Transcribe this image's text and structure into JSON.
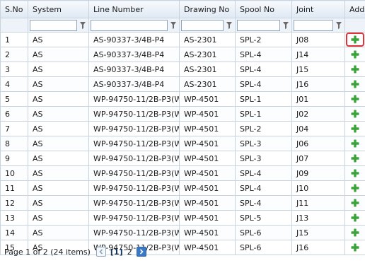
{
  "columns": [
    "S.No",
    "System",
    "Line Number",
    "Drawing No",
    "Spool No",
    "Joint",
    "Add"
  ],
  "filter_values": [
    "",
    "",
    "",
    "",
    ""
  ],
  "rows": [
    {
      "sno": "1",
      "system": "AS",
      "line": "AS-90337-3/4B-P4",
      "drawing": "AS-2301",
      "spool": "SPL-2",
      "joint": "J08"
    },
    {
      "sno": "2",
      "system": "AS",
      "line": "AS-90337-3/4B-P4",
      "drawing": "AS-2301",
      "spool": "SPL-4",
      "joint": "J14"
    },
    {
      "sno": "3",
      "system": "AS",
      "line": "AS-90337-3/4B-P4",
      "drawing": "AS-2301",
      "spool": "SPL-4",
      "joint": "J15"
    },
    {
      "sno": "4",
      "system": "AS",
      "line": "AS-90337-3/4B-P4",
      "drawing": "AS-2301",
      "spool": "SPL-4",
      "joint": "J16"
    },
    {
      "sno": "5",
      "system": "AS",
      "line": "WP-94750-11/2B-P3(WP)",
      "drawing": "WP-4501",
      "spool": "SPL-1",
      "joint": "J01"
    },
    {
      "sno": "6",
      "system": "AS",
      "line": "WP-94750-11/2B-P3(WP)",
      "drawing": "WP-4501",
      "spool": "SPL-1",
      "joint": "J02"
    },
    {
      "sno": "7",
      "system": "AS",
      "line": "WP-94750-11/2B-P3(WP)",
      "drawing": "WP-4501",
      "spool": "SPL-2",
      "joint": "J04"
    },
    {
      "sno": "8",
      "system": "AS",
      "line": "WP-94750-11/2B-P3(WP)",
      "drawing": "WP-4501",
      "spool": "SPL-3",
      "joint": "J06"
    },
    {
      "sno": "9",
      "system": "AS",
      "line": "WP-94750-11/2B-P3(WP)",
      "drawing": "WP-4501",
      "spool": "SPL-3",
      "joint": "J07"
    },
    {
      "sno": "10",
      "system": "AS",
      "line": "WP-94750-11/2B-P3(WP)",
      "drawing": "WP-4501",
      "spool": "SPL-4",
      "joint": "J09"
    },
    {
      "sno": "11",
      "system": "AS",
      "line": "WP-94750-11/2B-P3(WP)",
      "drawing": "WP-4501",
      "spool": "SPL-4",
      "joint": "J10"
    },
    {
      "sno": "12",
      "system": "AS",
      "line": "WP-94750-11/2B-P3(WP)",
      "drawing": "WP-4501",
      "spool": "SPL-4",
      "joint": "J11"
    },
    {
      "sno": "13",
      "system": "AS",
      "line": "WP-94750-11/2B-P3(WP)",
      "drawing": "WP-4501",
      "spool": "SPL-5",
      "joint": "J13"
    },
    {
      "sno": "14",
      "system": "AS",
      "line": "WP-94750-11/2B-P3(WP)",
      "drawing": "WP-4501",
      "spool": "SPL-6",
      "joint": "J15"
    },
    {
      "sno": "15",
      "system": "AS",
      "line": "WP-94750-11/2B-P3(WP)",
      "drawing": "WP-4501",
      "spool": "SPL-6",
      "joint": "J16"
    }
  ],
  "add_icon": "plus-icon",
  "highlighted_row_index": 0,
  "colors": {
    "header_bg": "#dfe8f3",
    "grid_line": "#c9d3de",
    "add_green": "#3aa33a",
    "highlight_red": "#e0333a",
    "pager_next": "#3a78c9"
  },
  "pager": {
    "summary": "Page 1 of 2 (24 items)",
    "pages": [
      "[1]",
      "2"
    ],
    "current_page": "[1]"
  }
}
